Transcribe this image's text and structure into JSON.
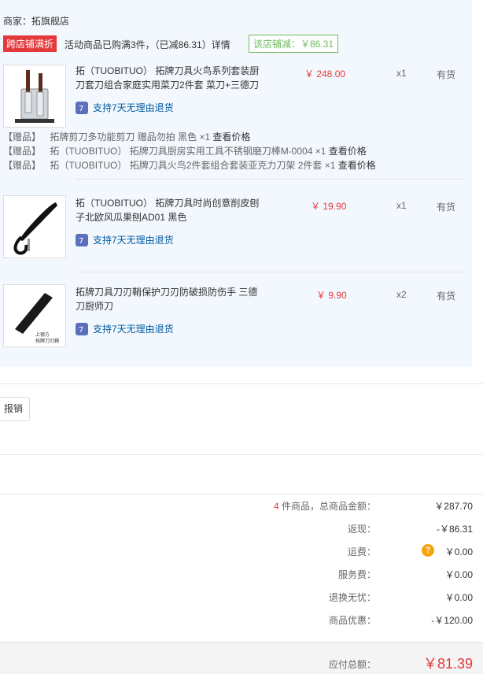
{
  "shop": {
    "merchant": "商家：拓旗舰店",
    "promo_badge": "跨店铺满折",
    "promo_text": "活动商品已购满3件，（已减86.31）详情",
    "store_discount": "该店铺减：￥86.31"
  },
  "items": [
    {
      "name": "拓（TUOBITUO） 拓牌刀具火鸟系列套装厨刀套刀组合家庭实用菜刀2件套 菜刀+三德刀",
      "price": "￥ 248.00",
      "qty": "x1",
      "stock": "有货",
      "service": "支持7天无理由退货",
      "thumb_icon": "knife-block-image"
    },
    {
      "name": "拓（TUOBITUO） 拓牌刀具时尚创意削皮刨子北欧风瓜果刨AD01 黑色",
      "price": "￥ 19.90",
      "qty": "x1",
      "stock": "有货",
      "service": "支持7天无理由退货",
      "thumb_icon": "peeler-image"
    },
    {
      "name": "拓牌刀具刀刃鞘保护刀刃防破损防伤手 三德刀厨师刀",
      "price": "￥ 9.90",
      "qty": "x2",
      "stock": "有货",
      "service": "支持7天无理由退货",
      "thumb_icon": "knife-sheath-image",
      "thumb_caption_1": "上德方",
      "thumb_caption_2": "拓牌刀刃鞘"
    }
  ],
  "gifts": [
    {
      "tag": "【赠品】",
      "name": "拓牌剪刀多功能剪刀 赠品勿拍 黑色 ×1",
      "link": "查看价格"
    },
    {
      "tag": "【赠品】",
      "name": "拓（TUOBITUO） 拓牌刀具厨房实用工具不锈钢磨刀棒M-0004 ×1",
      "link": "查看价格"
    },
    {
      "tag": "【赠品】",
      "name": "拓（TUOBITUO） 拓牌刀具火鸟2件套组合套装亚克力刀架 2件套 ×1",
      "link": "查看价格"
    }
  ],
  "reimburse_button": "报销",
  "summary": {
    "count": "4",
    "count_suffix": " 件商品，总商品金额：",
    "rows": [
      {
        "label": "返现：",
        "value": "-￥86.31"
      },
      {
        "label": "运费：",
        "value": "￥0.00"
      },
      {
        "label": "服务费：",
        "value": "￥0.00"
      },
      {
        "label": "退换无忧：",
        "value": "￥0.00"
      },
      {
        "label": "商品优惠：",
        "value": "-￥120.00"
      }
    ],
    "goods_total": "￥287.70",
    "help_icon_text": "?",
    "payable_label": "应付总额：",
    "payable_value": "￥81.39"
  },
  "colors": {
    "accent": "#e4393c",
    "panel": "#f3f8fe",
    "discount_green": "#6cbb5a",
    "link_blue": "#005aa0"
  }
}
